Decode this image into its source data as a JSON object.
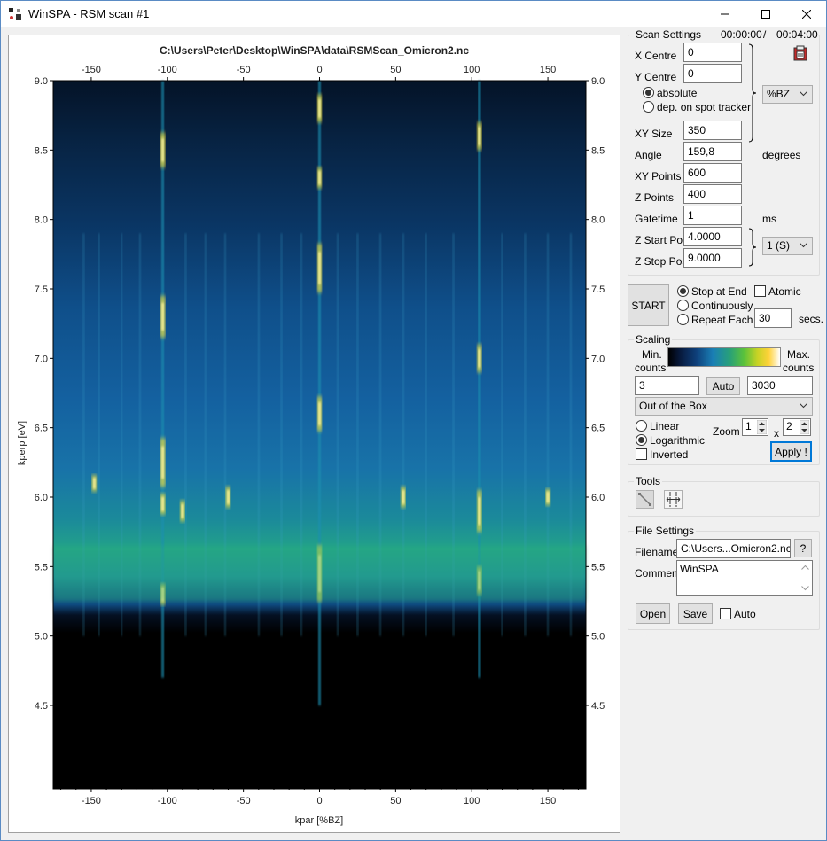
{
  "window": {
    "title": "WinSPA - RSM scan #1"
  },
  "plot": {
    "title": "C:\\Users\\Peter\\Desktop\\WinSPA\\data\\RSMScan_Omicron2.nc",
    "xlabel": "kpar [%BZ]",
    "ylabel": "kperp [eV]",
    "x_ticks": [
      "-150",
      "-100",
      "-50",
      "0",
      "50",
      "100",
      "150"
    ],
    "y_ticks": [
      "9.0",
      "8.5",
      "8.0",
      "7.5",
      "7.0",
      "6.5",
      "6.0",
      "5.5",
      "5.0",
      "4.5"
    ]
  },
  "scan_settings": {
    "group_label": "Scan Settings",
    "elapsed": "00:00:00",
    "separator": "/",
    "total": "00:04:00",
    "x_centre_label": "X Centre",
    "x_centre": "0",
    "y_centre_label": "Y Centre",
    "y_centre": "0",
    "absolute_label": "absolute",
    "spot_tracker_label": "dep. on spot tracker",
    "unit_combo": "%BZ",
    "xy_size_label": "XY Size",
    "xy_size": "350",
    "angle_label": "Angle",
    "angle": "159,8",
    "angle_unit": "degrees",
    "xy_points_label": "XY Points",
    "xy_points": "600",
    "z_points_label": "Z Points",
    "z_points": "400",
    "gatetime_label": "Gatetime",
    "gatetime": "1",
    "gatetime_unit": "ms",
    "z_start_label": "Z Start Pos.",
    "z_start": "4.0000",
    "z_stop_label": "Z Stop Pos.",
    "z_stop": "9.0000",
    "z_combo": "1 (S)"
  },
  "run": {
    "start_label": "START",
    "stop_at_end": "Stop at End",
    "continuously": "Continuously",
    "repeat_each": "Repeat Each",
    "repeat_value": "30",
    "repeat_unit": "secs.",
    "atomic": "Atomic"
  },
  "scaling": {
    "group_label": "Scaling",
    "min_label": "Min.",
    "counts_left": "counts",
    "max_label": "Max.",
    "counts_right": "counts",
    "min_value": "3",
    "auto_label": "Auto",
    "max_value": "3030",
    "mode_combo": "Out of the Box",
    "linear": "Linear",
    "logarithmic": "Logarithmic",
    "inverted": "Inverted",
    "zoom_label": "Zoom",
    "zoom_x": "1",
    "zoom_times": "x",
    "zoom_y": "2",
    "apply_label": "Apply !"
  },
  "tools": {
    "group_label": "Tools"
  },
  "file_settings": {
    "group_label": "File Settings",
    "filename_label": "Filename",
    "filename": "C:\\Users...Omicron2.nc",
    "help_label": "?",
    "comment_label": "Comment",
    "comment": "WinSPA",
    "open_label": "Open",
    "save_label": "Save",
    "auto_label": "Auto"
  },
  "icons": {
    "app": "app-icon",
    "clipboard": "clipboard-icon",
    "tool1": "line-profile-icon",
    "tool2": "grid-tool-icon"
  }
}
